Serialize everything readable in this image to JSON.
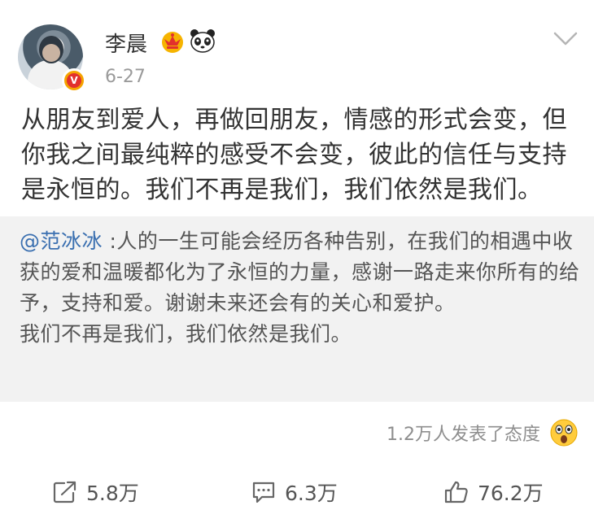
{
  "post": {
    "author": "李晨",
    "date": "6-27",
    "text": "从朋友到爱人，再做回朋友，情感的形式会变，但你我之间最纯粹的感受不会变，彼此的信任与支持是永恒的。我们不再是我们，我们依然是我们。",
    "badge_icon": "verified-v-icon",
    "badges": [
      "crown-icon",
      "panda-icon"
    ]
  },
  "repost": {
    "author": "@范冰冰",
    "separator": " :",
    "text": "人的一生可能会经历各种告别，在我们的相遇中收获的爱和温暖都化为了永恒的力量，感谢一路走来你所有的给予，支持和爱。谢谢未来还会有的关心和爱护。",
    "text2": "我们不再是我们，我们依然是我们。"
  },
  "reactions": {
    "summary": "1.2万人发表了态度",
    "emoji_icon": "surprise-emoji-icon"
  },
  "actions": {
    "repost_count": "5.8万",
    "comment_count": "6.3万",
    "like_count": "76.2万"
  },
  "colors": {
    "link": "#3a6fb0",
    "repost_bg": "#f2f2f2",
    "badge_gold": "#f5a400",
    "badge_red": "#e2312d"
  }
}
